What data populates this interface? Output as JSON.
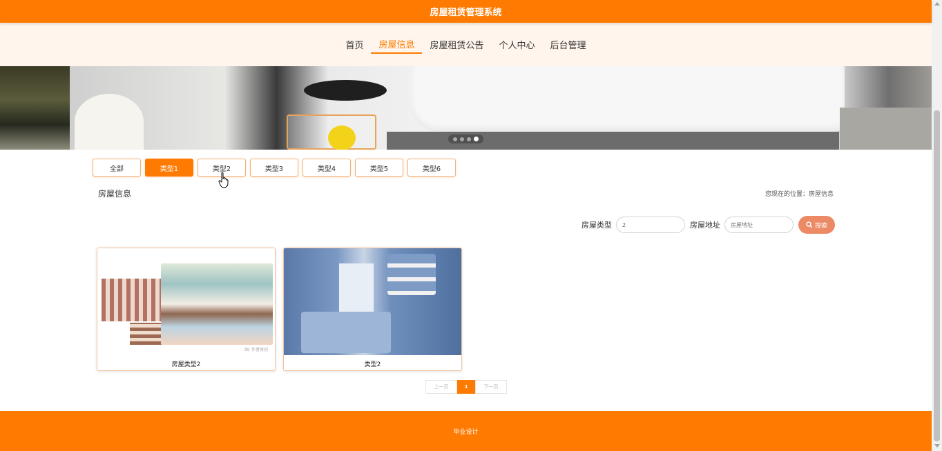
{
  "header": {
    "title": "房屋租赁管理系统"
  },
  "nav": {
    "items": [
      {
        "label": "首页",
        "active": false
      },
      {
        "label": "房屋信息",
        "active": true
      },
      {
        "label": "房屋租赁公告",
        "active": false
      },
      {
        "label": "个人中心",
        "active": false
      },
      {
        "label": "后台管理",
        "active": false
      }
    ]
  },
  "carousel": {
    "slide_count": 4,
    "active_index": 3
  },
  "filters": {
    "items": [
      "全部",
      "类型1",
      "类型2",
      "类型3",
      "类型4",
      "类型5",
      "类型6"
    ],
    "active_index": 1
  },
  "section": {
    "title": "房屋信息",
    "breadcrumb": "您现在的位置：房屋信息"
  },
  "search": {
    "type_label": "房屋类型",
    "type_value": "2",
    "address_label": "房屋地址",
    "address_placeholder": "房屋地址",
    "button_label": "搜索",
    "button_icon": "search-icon"
  },
  "listings": [
    {
      "caption": "房屋类型2",
      "image": "sketch-floorplan-bedroom",
      "watermark": "图: 作者原创"
    },
    {
      "caption": "类型2",
      "image": "blue-kids-bedroom"
    }
  ],
  "pagination": {
    "prev": "上一页",
    "current": "1",
    "next": "下一页"
  },
  "footer": {
    "text": "毕业设计"
  },
  "colors": {
    "brand": "#ff7a00",
    "nav_bg": "#fff5ec",
    "search_button": "#ec8a66"
  }
}
